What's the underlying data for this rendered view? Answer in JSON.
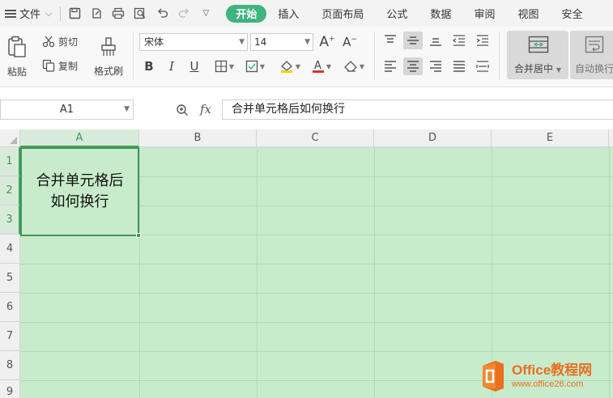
{
  "menubar": {
    "file_label": "文件",
    "tabs": [
      {
        "label": "开始",
        "active": true
      },
      {
        "label": "插入"
      },
      {
        "label": "页面布局"
      },
      {
        "label": "公式"
      },
      {
        "label": "数据"
      },
      {
        "label": "审阅"
      },
      {
        "label": "视图"
      },
      {
        "label": "安全"
      }
    ]
  },
  "ribbon": {
    "paste_label": "粘贴",
    "cut_label": "剪切",
    "copy_label": "复制",
    "format_painter_label": "格式刷",
    "font_name": "宋体",
    "font_size": "14",
    "merge_center_label": "合并居中",
    "auto_wrap_label": "自动换行"
  },
  "formula_bar": {
    "name_box": "A1",
    "fx_label": "fx",
    "content": "合并单元格后如何换行"
  },
  "sheet": {
    "columns": [
      "A",
      "B",
      "C",
      "D",
      "E"
    ],
    "rows": [
      "1",
      "2",
      "3",
      "4",
      "5",
      "6",
      "7",
      "8",
      "9"
    ],
    "merged_cell": {
      "line1": "合并单元格后",
      "line2": "如何换行"
    },
    "fill_color": "#c7ebcb",
    "selection_color": "#3a9a55"
  },
  "watermark": {
    "title": "Office教程网",
    "url": "www.office26.com"
  }
}
